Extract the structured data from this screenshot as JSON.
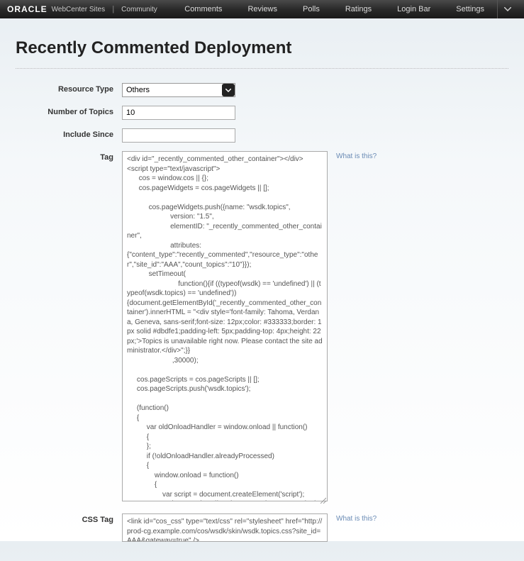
{
  "header": {
    "brand": "ORACLE",
    "product": "WebCenter Sites",
    "section": "Community",
    "nav": [
      "Comments",
      "Reviews",
      "Polls",
      "Ratings",
      "Login Bar",
      "Settings"
    ]
  },
  "page": {
    "title": "Recently Commented Deployment"
  },
  "form": {
    "resource_type_label": "Resource Type",
    "resource_type_value": "Others",
    "number_topics_label": "Number of Topics",
    "number_topics_value": "10",
    "include_since_label": "Include Since",
    "include_since_value": "",
    "tag_label": "Tag",
    "tag_value": "<div id=\"_recently_commented_other_container\"></div>\n<script type=\"text/javascript\">\n      cos = window.cos || {};\n      cos.pageWidgets = cos.pageWidgets || [];\n\n           cos.pageWidgets.push({name: \"wsdk.topics\",\n                      version: \"1.5\",\n                      elementID: \"_recently_commented_other_container\",\n                      attributes:\n{\"content_type\":\"recently_commented\",\"resource_type\":\"other\",\"site_id\":\"AAA\",\"count_topics\":\"10\"}});\n           setTimeout(\n                          function(){if ((typeof(wsdk) == 'undefined') || (typeof(wsdk.topics) == 'undefined'))\n{document.getElementById('_recently_commented_other_container').innerHTML = \"<div style='font-family: Tahoma, Verdana, Geneva, sans-serif;font-size: 12px;color: #333333;border: 1px solid #dbdfe1;padding-left: 5px;padding-top: 4px;height: 22px;'>Topics is unavailable right now. Please contact the site administrator.</div>\";}}\n                       ,30000);\n\n     cos.pageScripts = cos.pageScripts || [];\n     cos.pageScripts.push('wsdk.topics');\n\n     (function()\n     {\n          var oldOnloadHandler = window.onload || function()\n          {\n          };\n          if (!oldOnloadHandler.alreadyProcessed)\n          {\n              window.onload = function()\n              {\n                  var script = document.createElement('script');\n                  script.src = 'http://prod-cg.example.com:8080/cg/'\n\n                          + cos.pageScripts.join(':') + '.js?site_id=AAA';\n                  script.type = 'text/javascript';\n                  script.charset = 'utf-8';\n\ndocument.getElementsByTagName(\"head\").item(0).appendChild(script);\n                  oldOnloadHandler.apply(this, arguments);\n              };\n              window.onload.alreadyProcessed = true;\n          }\n\n     })();\n</script>",
    "css_tag_label": "CSS Tag",
    "css_tag_value": "<link id=\"cos_css\" type=\"text/css\" rel=\"stylesheet\" href=\"http://prod-cg.example.com/cos/wsdk/skin/wsdk.topics.css?site_id=AAA&gateway=true\" />",
    "help_text": "What is this?"
  }
}
